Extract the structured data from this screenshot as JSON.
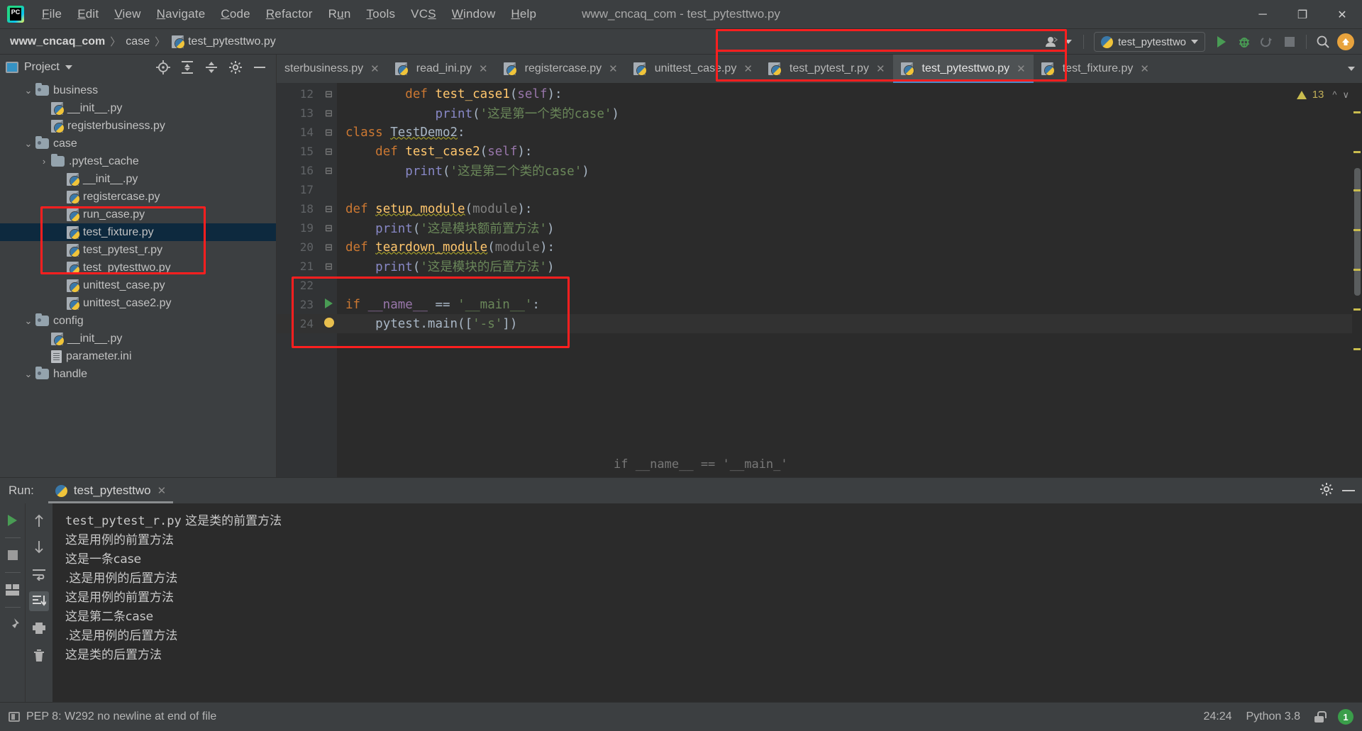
{
  "window": {
    "title": "www_cncaq_com - test_pytesttwo.py",
    "minimize": "─",
    "maximize": "❐",
    "close": "✕"
  },
  "menu": [
    {
      "label": "File"
    },
    {
      "label": "Edit"
    },
    {
      "label": "View"
    },
    {
      "label": "Navigate"
    },
    {
      "label": "Code"
    },
    {
      "label": "Refactor"
    },
    {
      "label": "Run"
    },
    {
      "label": "Tools"
    },
    {
      "label": "VCS"
    },
    {
      "label": "Window"
    },
    {
      "label": "Help"
    }
  ],
  "breadcrumb": {
    "project": "www_cncaq_com",
    "folder": "case",
    "file": "test_pytesttwo.py",
    "separator": "〉"
  },
  "toolbar": {
    "run_config_name": "test_pytesttwo",
    "run_icon": "run-icon",
    "debug_icon": "debug-icon",
    "coverage_icon": "coverage-icon",
    "stop_icon": "stop-icon",
    "search_icon": "search-icon",
    "update_icon": "update-icon",
    "account_icon": "account-icon"
  },
  "project_panel": {
    "title": "Project",
    "tools": [
      "locate-icon",
      "expand-all-icon",
      "collapse-all-icon",
      "settings-icon",
      "hide-icon"
    ],
    "tree": [
      {
        "label": "business",
        "type": "folder",
        "indent": 1,
        "arrow": "⌄",
        "selected": false
      },
      {
        "label": "__init__.py",
        "type": "py",
        "indent": 2,
        "arrow": "",
        "selected": false
      },
      {
        "label": "registerbusiness.py",
        "type": "py",
        "indent": 2,
        "arrow": "",
        "selected": false
      },
      {
        "label": "case",
        "type": "folder",
        "indent": 1,
        "arrow": "⌄",
        "selected": false
      },
      {
        "label": ".pytest_cache",
        "type": "folder-plain",
        "indent": 2,
        "arrow": "›",
        "selected": false
      },
      {
        "label": "__init__.py",
        "type": "py",
        "indent": 3,
        "arrow": "",
        "selected": false
      },
      {
        "label": "registercase.py",
        "type": "py",
        "indent": 3,
        "arrow": "",
        "selected": false
      },
      {
        "label": "run_case.py",
        "type": "py",
        "indent": 3,
        "arrow": "",
        "selected": false
      },
      {
        "label": "test_fixture.py",
        "type": "py",
        "indent": 3,
        "arrow": "",
        "selected": true
      },
      {
        "label": "test_pytest_r.py",
        "type": "py",
        "indent": 3,
        "arrow": "",
        "selected": false
      },
      {
        "label": "test_pytesttwo.py",
        "type": "py",
        "indent": 3,
        "arrow": "",
        "selected": false
      },
      {
        "label": "unittest_case.py",
        "type": "py",
        "indent": 3,
        "arrow": "",
        "selected": false
      },
      {
        "label": "unittest_case2.py",
        "type": "py",
        "indent": 3,
        "arrow": "",
        "selected": false
      },
      {
        "label": "config",
        "type": "folder",
        "indent": 1,
        "arrow": "⌄",
        "selected": false
      },
      {
        "label": "__init__.py",
        "type": "py",
        "indent": 2,
        "arrow": "",
        "selected": false
      },
      {
        "label": "parameter.ini",
        "type": "ini",
        "indent": 2,
        "arrow": "",
        "selected": false
      },
      {
        "label": "handle",
        "type": "folder",
        "indent": 1,
        "arrow": "⌄",
        "selected": false
      }
    ]
  },
  "editor_tabs": [
    {
      "label": "sterbusiness.py",
      "active": false,
      "truncated": true
    },
    {
      "label": "read_ini.py",
      "active": false,
      "truncated": false
    },
    {
      "label": "registercase.py",
      "active": false,
      "truncated": false
    },
    {
      "label": "unittest_case.py",
      "active": false,
      "truncated": false
    },
    {
      "label": "test_pytest_r.py",
      "active": false,
      "truncated": false
    },
    {
      "label": "test_pytesttwo.py",
      "active": true,
      "truncated": false
    },
    {
      "label": "test_fixture.py",
      "active": false,
      "truncated": false
    }
  ],
  "editor": {
    "inspection_count": "13",
    "ghost_line": "if __name__ == '__main_'",
    "lines": [
      {
        "num": "12",
        "fold": "⊟",
        "indent": 8,
        "tokens": [
          {
            "t": "def ",
            "c": "kw"
          },
          {
            "t": "test_case1",
            "c": "fn"
          },
          {
            "t": "(",
            "c": "punct"
          },
          {
            "t": "self",
            "c": "param"
          },
          {
            "t": "):",
            "c": "punct"
          }
        ]
      },
      {
        "num": "13",
        "fold": "⊟",
        "indent": 12,
        "tokens": [
          {
            "t": "print",
            "c": "bi"
          },
          {
            "t": "(",
            "c": "punct"
          },
          {
            "t": "'这是第一个类的case'",
            "c": "str"
          },
          {
            "t": ")",
            "c": "punct"
          }
        ]
      },
      {
        "num": "14",
        "fold": "⊟",
        "indent": 0,
        "tokens": [
          {
            "t": "class ",
            "c": "kw"
          },
          {
            "t": "TestDemo2",
            "c": "cls squig"
          },
          {
            "t": ":",
            "c": "punct"
          }
        ]
      },
      {
        "num": "15",
        "fold": "⊟",
        "indent": 4,
        "tokens": [
          {
            "t": "def ",
            "c": "kw"
          },
          {
            "t": "test_case2",
            "c": "fn"
          },
          {
            "t": "(",
            "c": "punct"
          },
          {
            "t": "self",
            "c": "param"
          },
          {
            "t": "):",
            "c": "punct"
          }
        ]
      },
      {
        "num": "16",
        "fold": "⊟",
        "indent": 8,
        "tokens": [
          {
            "t": "print",
            "c": "bi"
          },
          {
            "t": "(",
            "c": "punct"
          },
          {
            "t": "'这是第二个类的case'",
            "c": "str"
          },
          {
            "t": ")",
            "c": "punct"
          }
        ]
      },
      {
        "num": "17",
        "fold": "",
        "indent": 0,
        "tokens": []
      },
      {
        "num": "18",
        "fold": "⊟",
        "indent": 0,
        "tokens": [
          {
            "t": "def ",
            "c": "kw"
          },
          {
            "t": "setup_module",
            "c": "fn squig"
          },
          {
            "t": "(",
            "c": "punct"
          },
          {
            "t": "module",
            "c": "gray"
          },
          {
            "t": "):",
            "c": "punct"
          }
        ]
      },
      {
        "num": "19",
        "fold": "⊟",
        "indent": 4,
        "tokens": [
          {
            "t": "print",
            "c": "bi"
          },
          {
            "t": "(",
            "c": "punct"
          },
          {
            "t": "'这是模块额前置方法'",
            "c": "str"
          },
          {
            "t": ")",
            "c": "punct"
          }
        ]
      },
      {
        "num": "20",
        "fold": "⊟",
        "indent": 0,
        "tokens": [
          {
            "t": "def ",
            "c": "kw"
          },
          {
            "t": "teardown_module",
            "c": "fn squig"
          },
          {
            "t": "(",
            "c": "punct"
          },
          {
            "t": "module",
            "c": "gray"
          },
          {
            "t": "):",
            "c": "punct"
          }
        ]
      },
      {
        "num": "21",
        "fold": "⊟",
        "indent": 4,
        "tokens": [
          {
            "t": "print",
            "c": "bi"
          },
          {
            "t": "(",
            "c": "punct"
          },
          {
            "t": "'这是模块的后置方法'",
            "c": "str"
          },
          {
            "t": ")",
            "c": "punct"
          }
        ]
      },
      {
        "num": "22",
        "fold": "",
        "indent": 0,
        "tokens": []
      },
      {
        "num": "23",
        "fold": "",
        "indent": 0,
        "gutterRun": true,
        "tokens": [
          {
            "t": "if ",
            "c": "kw"
          },
          {
            "t": "__name__",
            "c": "param"
          },
          {
            "t": " == ",
            "c": "punct"
          },
          {
            "t": "'__main__'",
            "c": "str"
          },
          {
            "t": ":",
            "c": "punct"
          }
        ]
      },
      {
        "num": "24",
        "fold": "",
        "indent": 4,
        "bulb": true,
        "highlight": true,
        "tokens": [
          {
            "t": "pytest",
            "c": "punct"
          },
          {
            "t": ".main([",
            "c": "punct"
          },
          {
            "t": "'-s'",
            "c": "str"
          },
          {
            "t": "])",
            "c": "punct"
          }
        ]
      }
    ]
  },
  "run_window": {
    "label": "Run:",
    "tab_name": "test_pytesttwo",
    "close_icon": "close-icon",
    "settings_icon": "gear-icon",
    "hide_icon": "hide-icon",
    "left_tools": [
      "rerun-icon",
      "stop-icon",
      "layout-icon",
      "pin-icon"
    ],
    "nav_tools": [
      "up-arrow-icon",
      "down-arrow-icon",
      "soft-wrap-icon",
      "scroll-to-end-icon",
      "print-icon",
      "trash-icon"
    ],
    "output": [
      {
        "mono": "test_pytest_r.py",
        "text": " 这是类的前置方法"
      },
      {
        "mono": "",
        "text": "这是用例的前置方法"
      },
      {
        "mono": "",
        "text": "这是一条case"
      },
      {
        "mono": "",
        "text": ".这是用例的后置方法"
      },
      {
        "mono": "",
        "text": "这是用例的前置方法"
      },
      {
        "mono": "",
        "text": "这是第二条case"
      },
      {
        "mono": "",
        "text": ".这是用例的后置方法"
      },
      {
        "mono": "",
        "text": "这是类的后置方法"
      }
    ]
  },
  "status_bar": {
    "message": "PEP 8: W292 no newline at end of file",
    "caret_position": "24:24",
    "interpreter": "Python 3.8",
    "lock_icon": "unlocked-icon",
    "notification_count": "1"
  },
  "colors": {
    "accent_blue": "#4a88c7",
    "selection": "#0d293e",
    "annotation_red": "#ff1f1f",
    "run_green": "#499c54",
    "editor_bg": "#2b2b2b",
    "panel_bg": "#3c3f41"
  }
}
